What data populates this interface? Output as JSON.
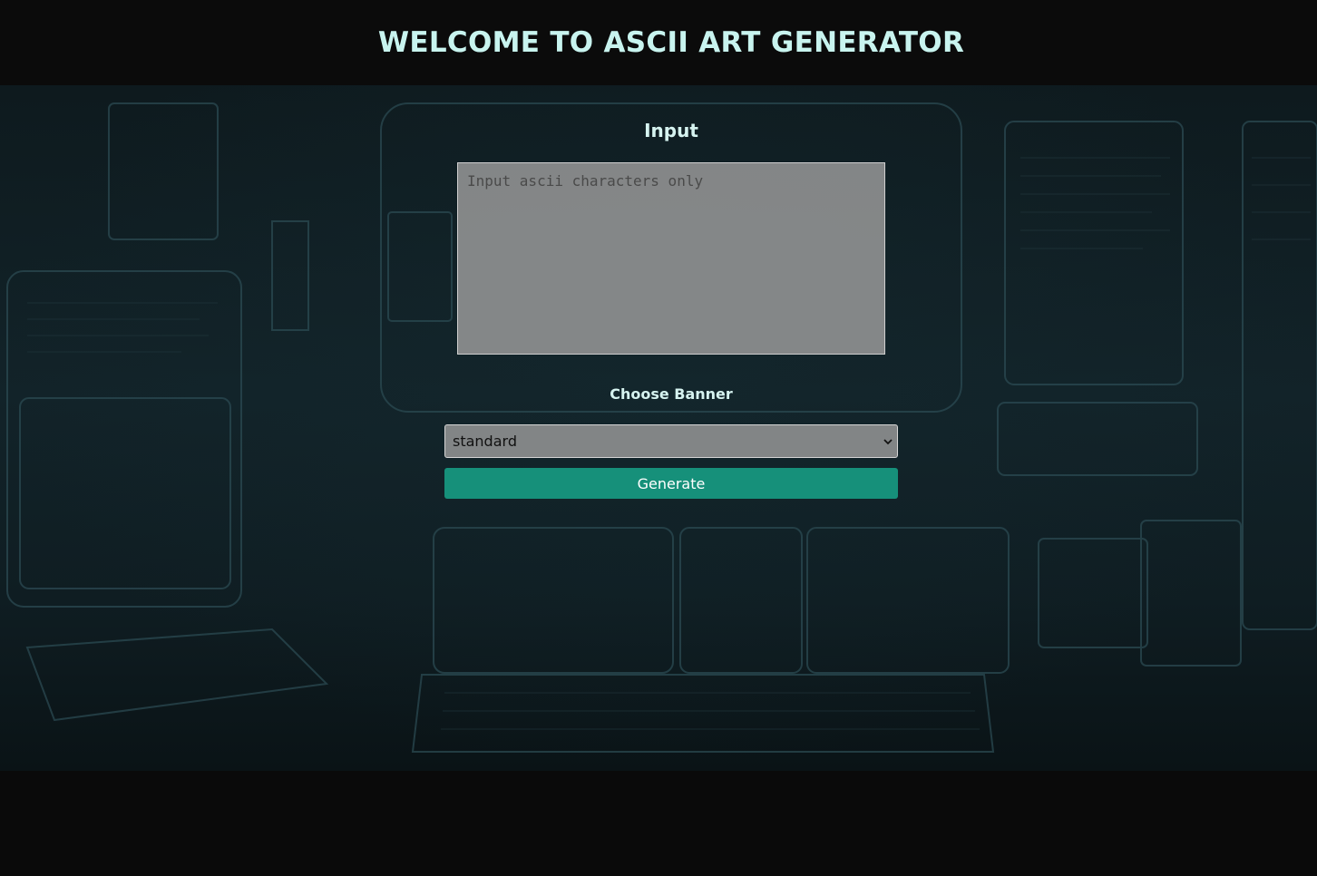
{
  "header": {
    "title": "WELCOME TO ASCII ART GENERATOR"
  },
  "form": {
    "input_label": "Input",
    "input_placeholder": "Input ascii characters only",
    "input_value": "",
    "banner_label": "Choose Banner",
    "banner_selected": "standard",
    "generate_label": "Generate"
  },
  "colors": {
    "title": "#c8f4ef",
    "button": "#16907a",
    "page_background": "#0a0a0a"
  }
}
